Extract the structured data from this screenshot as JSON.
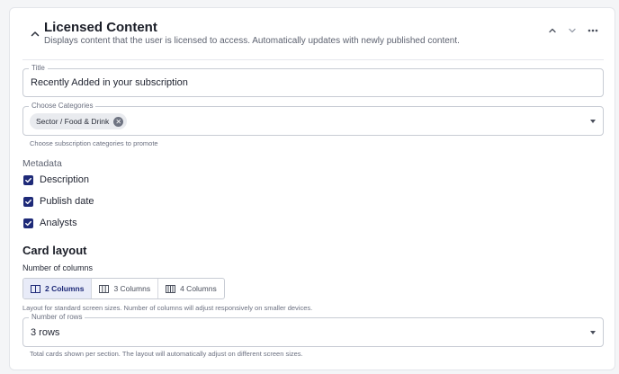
{
  "header": {
    "title": "Licensed Content",
    "subtitle": "Displays content that the user is licensed to access. Automatically updates with newly published content.",
    "collapse_icon": "chevron-up-icon",
    "move_up_icon": "chevron-up-icon",
    "move_down_icon": "chevron-down-icon",
    "more_icon": "more-horizontal-icon"
  },
  "title_field": {
    "legend": "Title",
    "value": "Recently Added in your subscription"
  },
  "categories_field": {
    "legend": "Choose Categories",
    "chips": [
      "Sector / Food & Drink"
    ],
    "help": "Choose subscription categories to promote"
  },
  "metadata": {
    "label": "Metadata",
    "options": [
      {
        "label": "Description",
        "checked": true
      },
      {
        "label": "Publish date",
        "checked": true
      },
      {
        "label": "Analysts",
        "checked": true
      }
    ]
  },
  "card_layout": {
    "heading": "Card layout",
    "columns_label": "Number of columns",
    "columns_options": [
      {
        "label": "2 Columns",
        "selected": true
      },
      {
        "label": "3 Columns",
        "selected": false
      },
      {
        "label": "4 Columns",
        "selected": false
      }
    ],
    "columns_help": "Layout for standard screen sizes. Number of columns will adjust responsively on smaller devices.",
    "rows_legend": "Number of rows",
    "rows_value": "3 rows",
    "rows_help": "Total cards shown per section. The layout will automatically adjust on different screen sizes."
  },
  "colors": {
    "accent": "#1e2a78",
    "segment_active_bg": "#e8ebf8",
    "border": "#c8ccd4"
  }
}
